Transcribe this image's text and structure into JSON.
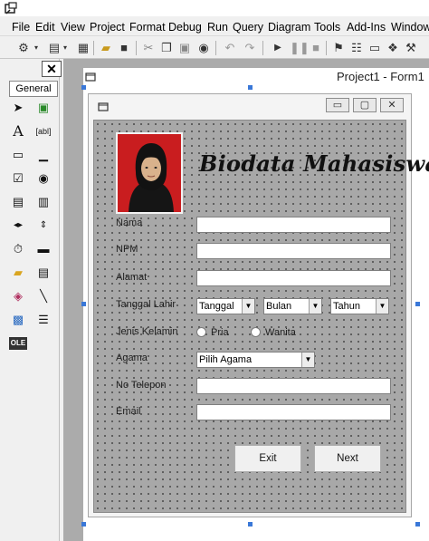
{
  "menu": [
    "File",
    "Edit",
    "View",
    "Project",
    "Format",
    "Debug",
    "Run",
    "Query",
    "Diagram",
    "Tools",
    "Add-Ins",
    "Window"
  ],
  "toolbox": {
    "close_label": "✕",
    "tab_label": "General",
    "tools": [
      "pointer-icon",
      "picturebox-icon",
      "label-icon",
      "textbox-icon",
      "frame-icon",
      "commandbutton-icon",
      "checkbox-icon",
      "optionbutton-icon",
      "combobox-icon",
      "listbox-icon",
      "hscrollbar-icon",
      "vscrollbar-icon",
      "timer-icon",
      "drivelistbox-icon",
      "dirlistbox-icon",
      "filelistbox-icon",
      "shape-icon",
      "line-icon",
      "image-icon",
      "data-icon",
      "ole-icon"
    ]
  },
  "designer": {
    "window_title": "Project1 - Form1"
  },
  "form": {
    "heading": "Biodata Mahasiswa",
    "fields": {
      "nama": "Nama",
      "npm": "NPM",
      "alamat": "Alamat",
      "tanggal_lahir": "Tanggal Lahir",
      "jenis_kelamin": "Jenis Kelamin",
      "agama": "Agama",
      "no_telepon": "No Telepon",
      "email": "Email"
    },
    "date": {
      "day": "Tanggal",
      "month": "Bulan",
      "year": "Tahun"
    },
    "gender": {
      "male": "Pria",
      "female": "Wanita"
    },
    "religion_select": "Pilih Agama",
    "buttons": {
      "exit": "Exit",
      "next": "Next"
    }
  },
  "colors": {
    "form_background": "#a8a8a8",
    "photo_background": "#c91d1f",
    "selection_handle": "#3a78d8"
  }
}
